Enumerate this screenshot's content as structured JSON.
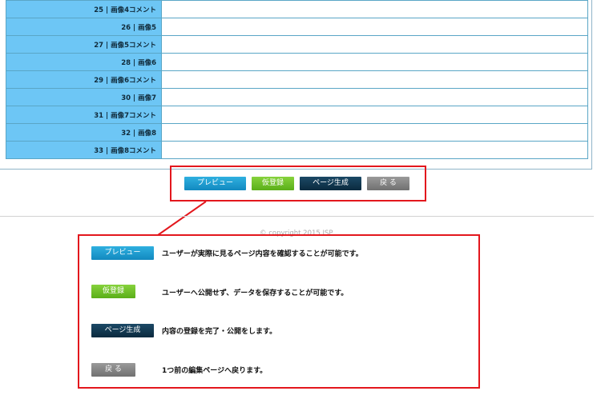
{
  "form": {
    "rows": [
      {
        "label": "25 | 画像4コメント"
      },
      {
        "label": "26 | 画像5"
      },
      {
        "label": "27 | 画像5コメント"
      },
      {
        "label": "28 | 画像6"
      },
      {
        "label": "29 | 画像6コメント"
      },
      {
        "label": "30 | 画像7"
      },
      {
        "label": "31 | 画像7コメント"
      },
      {
        "label": "32 | 画像8"
      },
      {
        "label": "33 | 画像8コメント"
      }
    ]
  },
  "actions": {
    "preview_label": "プレビュー",
    "draft_label": "仮登録",
    "publish_label": "ページ生成",
    "back_label": "戻 る"
  },
  "footer": {
    "copyright": "© copyright 2015 ISP"
  },
  "legend": {
    "items": [
      {
        "button": "プレビュー",
        "description": "ユーザーが実際に見るページ内容を確認することが可能です。"
      },
      {
        "button": "仮登録",
        "description": "ユーザーへ公開せず、データを保存することが可能です。"
      },
      {
        "button": "ページ生成",
        "description": "内容の登録を完了・公開をします。"
      },
      {
        "button": "戻 る",
        "description": "1つ前の編集ページへ戻ります。"
      }
    ]
  },
  "colors": {
    "label_bg": "#6dc6f5",
    "highlight": "#e3171d",
    "preview": "#1289bf",
    "draft": "#5aae18",
    "publish": "#0b2a3e",
    "back": "#707070"
  }
}
